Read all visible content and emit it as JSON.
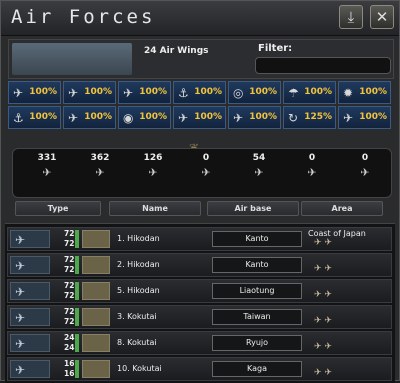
{
  "window": {
    "title": "Air Forces"
  },
  "header": {
    "air_wings": "24 Air Wings",
    "filter_label": "Filter:",
    "filter_value": ""
  },
  "missions": [
    {
      "icon": "fighter-icon",
      "value": "100%"
    },
    {
      "icon": "interceptor-icon",
      "value": "100%"
    },
    {
      "icon": "cas-icon",
      "value": "100%"
    },
    {
      "icon": "port-strike-icon",
      "value": "100%"
    },
    {
      "icon": "target-icon",
      "value": "100%"
    },
    {
      "icon": "paradrop-icon",
      "value": "100%"
    },
    {
      "icon": "bomb-icon",
      "value": "100%"
    },
    {
      "icon": "naval-strike-icon",
      "value": "100%"
    },
    {
      "icon": "recon-icon",
      "value": "100%"
    },
    {
      "icon": "eye-icon",
      "value": "100%"
    },
    {
      "icon": "carrier-icon",
      "value": "100%"
    },
    {
      "icon": "naval-bomber-icon",
      "value": "100%"
    },
    {
      "icon": "refuel-icon",
      "value": "125%"
    },
    {
      "icon": "kamikaze-icon",
      "value": "100%"
    }
  ],
  "counts": [
    {
      "value": "331",
      "icon": "fighter-silhouette-icon"
    },
    {
      "value": "362",
      "icon": "heavy-fighter-silhouette-icon"
    },
    {
      "value": "126",
      "icon": "cas-silhouette-icon"
    },
    {
      "value": "0",
      "icon": "tactical-bomber-silhouette-icon"
    },
    {
      "value": "54",
      "icon": "naval-bomber-silhouette-icon"
    },
    {
      "value": "0",
      "icon": "strategic-bomber-silhouette-icon"
    },
    {
      "value": "0",
      "icon": "transport-silhouette-icon"
    }
  ],
  "columns": {
    "type": "Type",
    "name": "Name",
    "air_base": "Air base",
    "area": "Area"
  },
  "wings": [
    {
      "num1": "72",
      "num2": "72",
      "name": "1. Hikodan",
      "base": "Kanto",
      "area": "Coast of Japan",
      "mission_icons": "✈ ✈"
    },
    {
      "num1": "72",
      "num2": "72",
      "name": "2. Hikodan",
      "base": "Kanto",
      "area": "",
      "mission_icons": "✈ ✈"
    },
    {
      "num1": "72",
      "num2": "72",
      "name": "5. Hikodan",
      "base": "Liaotung",
      "area": "",
      "mission_icons": "✈ ✈"
    },
    {
      "num1": "72",
      "num2": "72",
      "name": "3. Kokutai",
      "base": "Taiwan",
      "area": "",
      "mission_icons": "✈ ✈"
    },
    {
      "num1": "24",
      "num2": "24",
      "name": "8. Kokutai",
      "base": "Ryujo",
      "area": "",
      "mission_icons": "✈ ✈"
    },
    {
      "num1": "16",
      "num2": "16",
      "name": "10. Kokutai",
      "base": "Kaga",
      "area": "",
      "mission_icons": "✈ ✈"
    }
  ]
}
